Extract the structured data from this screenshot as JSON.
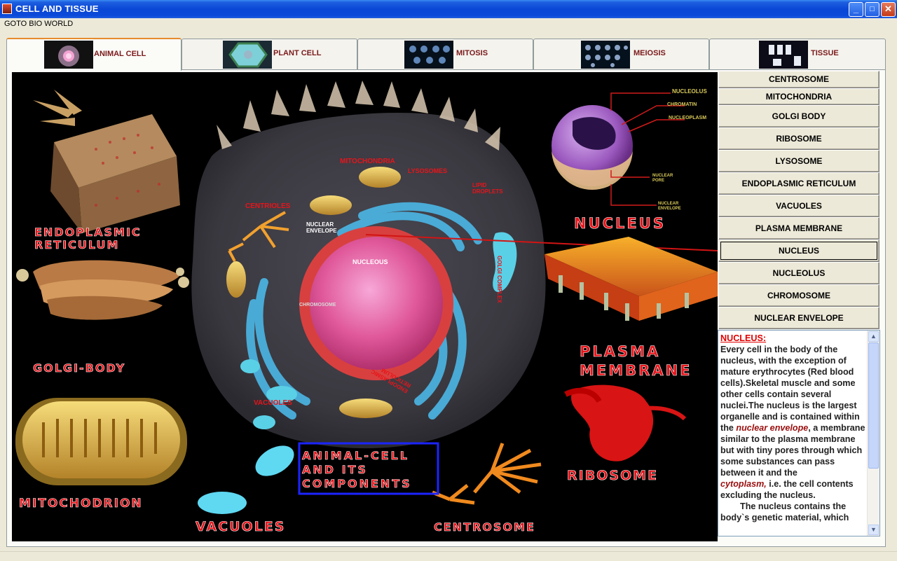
{
  "window": {
    "title": "CELL AND TISSUE",
    "controls": {
      "minimize": "_",
      "maximize": "□",
      "close": "✕"
    }
  },
  "menu": {
    "items": [
      "GOTO BIO WORLD"
    ]
  },
  "tabs": [
    {
      "label": "ANIMAL CELL",
      "active": true
    },
    {
      "label": "PLANT CELL",
      "active": false
    },
    {
      "label": "MITOSIS",
      "active": false
    },
    {
      "label": "MEIOSIS",
      "active": false
    },
    {
      "label": "TISSUE",
      "active": false
    }
  ],
  "organelles": [
    {
      "label": "CENTROSOME",
      "selected": false
    },
    {
      "label": "MITOCHONDRIA",
      "selected": false
    },
    {
      "label": "GOLGI BODY",
      "selected": false
    },
    {
      "label": "RIBOSOME",
      "selected": false
    },
    {
      "label": "LYSOSOME",
      "selected": false
    },
    {
      "label": "ENDOPLASMIC RETICULUM",
      "selected": false
    },
    {
      "label": "VACUOLES",
      "selected": false
    },
    {
      "label": "PLASMA MEMBRANE",
      "selected": false
    },
    {
      "label": "NUCLEUS",
      "selected": true
    },
    {
      "label": "NUCLEOLUS",
      "selected": false
    },
    {
      "label": "CHROMOSOME",
      "selected": false
    },
    {
      "label": "NUCLEAR ENVELOPE",
      "selected": false
    }
  ],
  "description": {
    "title": "NUCLEUS:",
    "p1": "Every cell in the body of the nucleus, with the exception of mature erythrocytes (Red blood cells).Skeletal muscle and some other cells contain several nuclei.The nucleus is the largest organelle and is contained within the",
    "em1": "nuclear envelope",
    "p2": ", a membrane similar to the plasma membrane but with tiny pores through which some substances can pass between it and the",
    "em2": "cytoplasm,",
    "p3": " i.e. the cell contents excluding the nucleus.",
    "p4": "The nucleus contains the body`s genetic material, which"
  },
  "diagram": {
    "labels": {
      "er": "ENDOPLASMIC\nRETICULUM",
      "golgi": "GOLGI-BODY",
      "mito": "MITOCHODRION",
      "vacuoles": "VACUOLES",
      "centrosome": "CENTROSOME",
      "ribosome": "RIBOSOME",
      "plasma": "PLASMA\nMEMBRANE",
      "nucleus": "NUCLEUS",
      "center_title": "ANIMAL-CELL\nAND ITS\nCOMPONENTS",
      "in_mitochondria": "MITOCHONDRIA",
      "in_lysosomes": "LYSOSOMES",
      "in_lipid": "LIPID\nDROPLETS",
      "in_centrioles": "CENTRIOLES",
      "in_nuclear_env": "NUCLEAR\nENVELOPE",
      "in_nucleous": "NUCLEOUS",
      "in_chromosome": "CHROMOSOME",
      "in_golgi": "GOLGI COMPLEX",
      "in_er": "ENDOPLASMIC\nRETICULUM",
      "in_vacuoles": "VACUOLES",
      "n_nucleolus": "NUCLEOLUS",
      "n_chromatin": "CHROMATIN",
      "n_nucleoplasm": "NUCLEOPLASM",
      "n_pore": "NUCLEAR\nPORE",
      "n_envelope": "NUCLEAR\nENVELOPE"
    },
    "colors": {
      "label_red": "#e8141a",
      "highlight_box": "#1b24ff",
      "nucleus_pink": "#e04a8a"
    }
  }
}
